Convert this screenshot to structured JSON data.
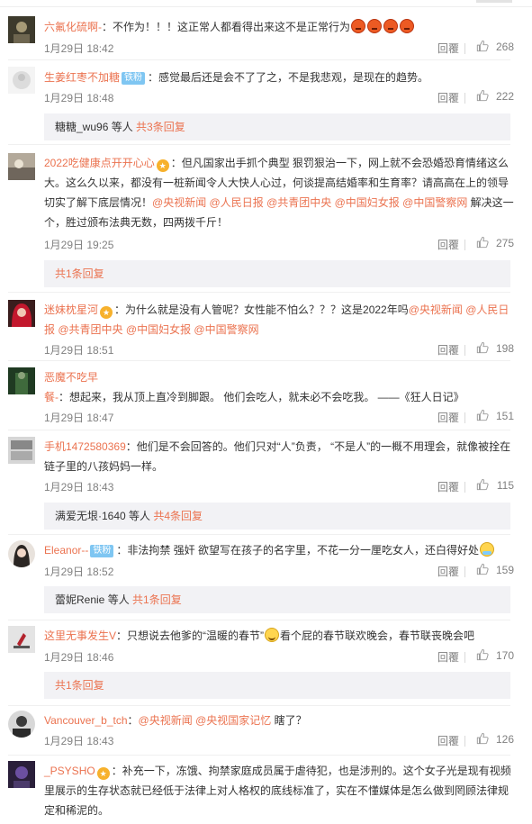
{
  "theme": {
    "link_color": "#eb7350",
    "meta_color": "#808080",
    "subreply_bg": "#f2f2f5"
  },
  "actions": {
    "reply_label": "回覆"
  },
  "comments": [
    {
      "user": "六氟化硫啊-",
      "text": "：不作为！！！这正常人都看得出来这不是正常行为",
      "time": "1月29日 18:42",
      "likes": "268",
      "emojis": [
        "angry-emoji",
        "angry-emoji",
        "angry-emoji",
        "angry-emoji"
      ]
    },
    {
      "user": "生姜红枣不加糖",
      "badge": "铁粉",
      "text": "：感觉最后还是会不了了之，不是我悲观，是现在的趋势。",
      "time": "1月29日 18:48",
      "likes": "222",
      "subreply": {
        "user": "糖糖_wu96",
        "rest": " 等人 ",
        "link": "共3条回复"
      }
    },
    {
      "user": "2022吃健康点开开心心",
      "badge_icon": "gold-fan-badge",
      "text1": "：但凡国家出手抓个典型 狠罚狠治一下，网上就不会恐婚恐育情绪这么大。这么久以来，都没有一桩新闻令人大快人心过，何谈提高结婚率和生育率？请高高在上的领导切实了解下底层情况！",
      "mentions": [
        "@央视新闻",
        "@人民日报",
        "@共青团中央",
        "@中国妇女报",
        "@中国警察网"
      ],
      "text2": " 解决这一个，胜过颁布法典无数，四两拨千斤！",
      "time": "1月29日 19:25",
      "likes": "275",
      "subreply": {
        "link": "共1条回复"
      }
    },
    {
      "user": "迷妹枕星河",
      "badge_icon": "gold-fan-badge",
      "text1": "：为什么就是没有人管呢？女性能不怕么？？？这是2022年吗",
      "mentions": [
        "@央视新闻",
        "@人民日报",
        "@共青团中央",
        "@中国妇女报",
        "@中国警察网"
      ],
      "time": "1月29日 18:51",
      "likes": "198"
    },
    {
      "user": "恶魔不吃早餐-",
      "text": "：想起来，我从顶上直冷到脚跟。 他们会吃人，就未必不会吃我。 ——《狂人日记》",
      "time": "1月29日 18:47",
      "likes": "151"
    },
    {
      "user": "手机1472580369",
      "text": "：他们是不会回答的。他们只对“人”负责， “不是人”的一概不用理会，就像被拴在链子里的八孩妈妈一样。",
      "time": "1月29日 18:43",
      "likes": "115",
      "subreply": {
        "user": "满爱无垠·1640",
        "rest": " 等人 ",
        "link": "共4条回复"
      }
    },
    {
      "user": "Eleanor--",
      "badge": "铁粉",
      "text": "：非法拘禁 强奸 欲望写在孩子的名字里，不花一分一厘吃女人，还白得好处",
      "emojis": [
        "sweat-emoji"
      ],
      "time": "1月29日 18:52",
      "likes": "159",
      "subreply": {
        "user": "蕾妮Renie",
        "rest": " 等人 ",
        "link": "共1条回复"
      }
    },
    {
      "user": "这里无事发生V",
      "text1": "：只想说去他爹的“温暖的春节”",
      "text2": "看个屁的春节联欢晚会，春节联丧晚会吧",
      "emojis": [
        "smile-emoji"
      ],
      "time": "1月29日 18:46",
      "likes": "170",
      "subreply": {
        "link": "共1条回复"
      }
    },
    {
      "user": "Vancouver_b_tch",
      "text1": "：",
      "mentions": [
        "@央视新闻",
        "@央视国家记忆"
      ],
      "text2": " 瞎了？",
      "time": "1月29日 18:43",
      "likes": "126"
    },
    {
      "user": "_PSYSHO",
      "badge_icon": "gold-fan-badge",
      "text": "：补充一下，冻饿、拘禁家庭成员属于虐待犯，也是涉刑的。这个女子光是现有视频里展示的生存状态就已经低于法律上对人格权的底线标准了，实在不懂媒体是怎么做到罔顾法律规定和稀泥的。"
    }
  ]
}
